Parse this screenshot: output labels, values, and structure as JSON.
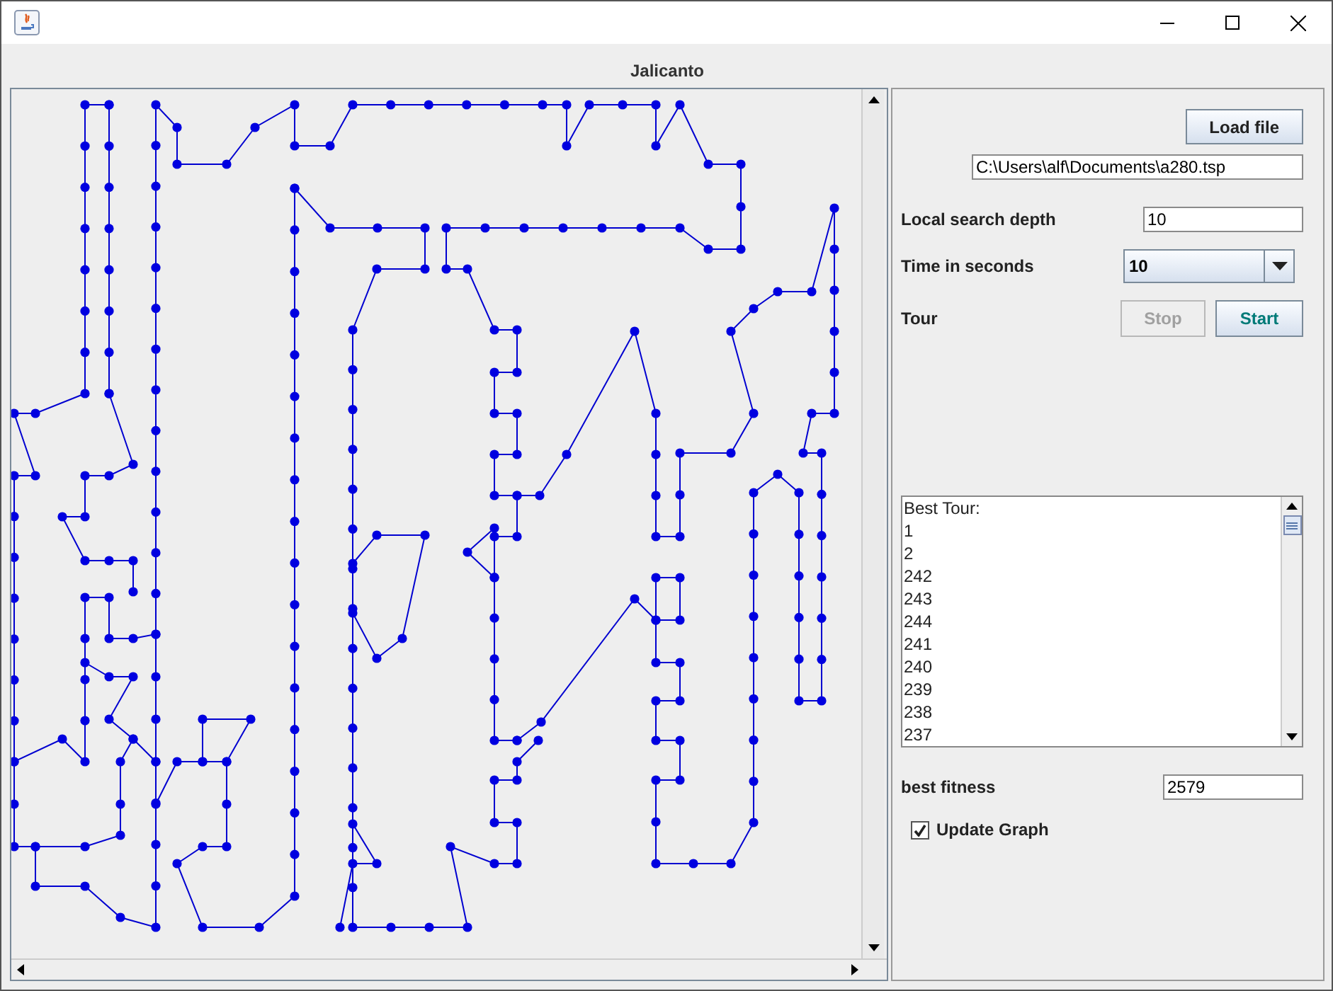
{
  "heading": "Jalicanto",
  "load_button": "Load file",
  "file_path": "C:\\Users\\alf\\Documents\\a280.tsp",
  "search_depth": {
    "label": "Local search depth",
    "value": "10"
  },
  "time": {
    "label": "Time in seconds",
    "value": "10"
  },
  "tour": {
    "label": "Tour",
    "buttons": [
      {
        "label": "Stop",
        "disabled": true
      },
      {
        "label": "Start",
        "disabled": false
      }
    ]
  },
  "best_tour": [
    "Best Tour:",
    "1",
    "2",
    "242",
    "243",
    "244",
    "241",
    "240",
    "239",
    "238",
    "237"
  ],
  "best_fitness": {
    "label": "best fitness",
    "value": "2579"
  },
  "update_graph": {
    "label": "Update Graph",
    "checked": true
  }
}
